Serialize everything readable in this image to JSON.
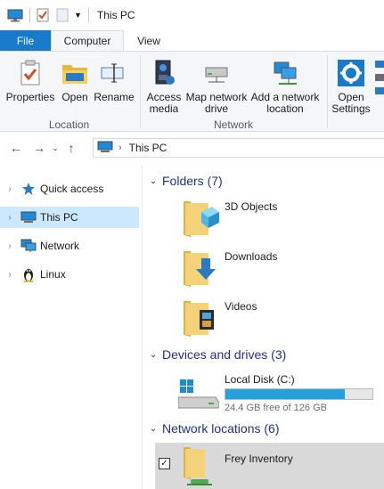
{
  "titlebar": {
    "title": "This PC"
  },
  "tabs": {
    "file": "File",
    "computer": "Computer",
    "view": "View"
  },
  "ribbon": {
    "properties": "Properties",
    "open": "Open",
    "rename": "Rename",
    "location_group": "Location",
    "access_media": "Access media",
    "map_network_drive": "Map network drive",
    "add_network_location": "Add a network location",
    "network_group": "Network",
    "open_settings": "Open Settings"
  },
  "address": {
    "path": "This PC"
  },
  "navpane": {
    "items": [
      {
        "label": "Quick access"
      },
      {
        "label": "This PC"
      },
      {
        "label": "Network"
      },
      {
        "label": "Linux"
      }
    ]
  },
  "content": {
    "folders_header": "Folders (7)",
    "folders": [
      {
        "label": "3D Objects"
      },
      {
        "label": "Downloads"
      },
      {
        "label": "Videos"
      }
    ],
    "devices_header": "Devices and drives (3)",
    "drive": {
      "label": "Local Disk (C:)",
      "free_text": "24.4 GB free of 126 GB",
      "used_fraction": 0.81
    },
    "network_header": "Network locations (6)",
    "network_items": [
      {
        "label": "Frey Inventory"
      }
    ]
  },
  "colors": {
    "accent": "#1979ca",
    "selection": "#cce8ff",
    "header_text": "#1e3287",
    "drive_fill": "#26a0da"
  }
}
